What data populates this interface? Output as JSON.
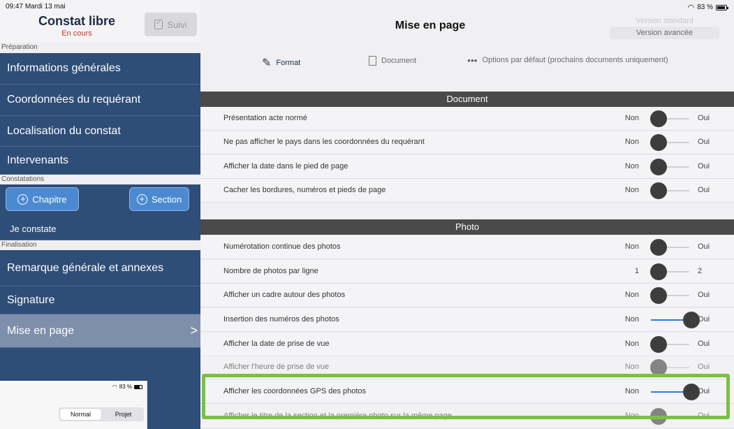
{
  "status": {
    "time": "09:47",
    "date": "Mardi 13 mai",
    "battery": "83 %"
  },
  "sidebar": {
    "title": "Constat libre",
    "subtitle": "En cours",
    "suivi_label": "Suivi",
    "sections": {
      "preparation": "Préparation",
      "constatations": "Constatations",
      "finalisation": "Finalisation"
    },
    "items": [
      "Informations générales",
      "Coordonnées du requérant",
      "Localisation du constat",
      "Intervenants",
      "Je constate",
      "Remarque générale et annexes",
      "Signature",
      "Mise en page"
    ],
    "chapitre_label": "Chapitre",
    "section_label": "Section",
    "chevron": ">"
  },
  "inset": {
    "battery": "83 %",
    "seg_normal": "Normal",
    "seg_projet": "Projet"
  },
  "header": {
    "title": "Mise en page",
    "version_standard": "Version standard",
    "version_avancee": "Version avancée"
  },
  "tabs": {
    "format": "Format",
    "document": "Document",
    "options": "Options par défaut (prochains documents uniquement)"
  },
  "groups": {
    "document": "Document",
    "photo": "Photo"
  },
  "rows": [
    {
      "label": "Présentation acte normé",
      "left": "Non",
      "right": "Oui",
      "value": "Non"
    },
    {
      "label": "Ne pas afficher le pays dans les coordonnées du requérant",
      "left": "Non",
      "right": "Oui",
      "value": "Non"
    },
    {
      "label": "Afficher la date dans le pied de page",
      "left": "Non",
      "right": "Oui",
      "value": "Non"
    },
    {
      "label": "Cacher les bordures, numéros et pieds de page",
      "left": "Non",
      "right": "Oui",
      "value": "Non"
    },
    {
      "label": "Numérotation continue des photos",
      "left": "Non",
      "right": "Oui",
      "value": "Non"
    },
    {
      "label": "Nombre de photos par ligne",
      "left": "1",
      "right": "2",
      "value": "1"
    },
    {
      "label": "Afficher un cadre autour des photos",
      "left": "Non",
      "right": "Oui",
      "value": "Non"
    },
    {
      "label": "Insertion des numéros des photos",
      "left": "Non",
      "right": "Oui",
      "value": "Oui"
    },
    {
      "label": "Afficher la date de prise de vue",
      "left": "Non",
      "right": "Oui",
      "value": "Non"
    },
    {
      "label": "Afficher l'heure de prise de vue",
      "left": "Non",
      "right": "Oui",
      "value": "Non"
    },
    {
      "label": "Afficher les coordonnées GPS des photos",
      "left": "Non",
      "right": "Oui",
      "value": "Oui"
    },
    {
      "label": "Afficher le titre de la section et la première photo sur la même page",
      "left": "Non",
      "right": "Oui",
      "value": "Non"
    }
  ],
  "colors": {
    "sidebar_bg": "#2e4d77",
    "active_item": "#7d8faa",
    "accent": "#2a7ae2",
    "highlight": "#7ac142",
    "status_red": "#d0312d"
  }
}
